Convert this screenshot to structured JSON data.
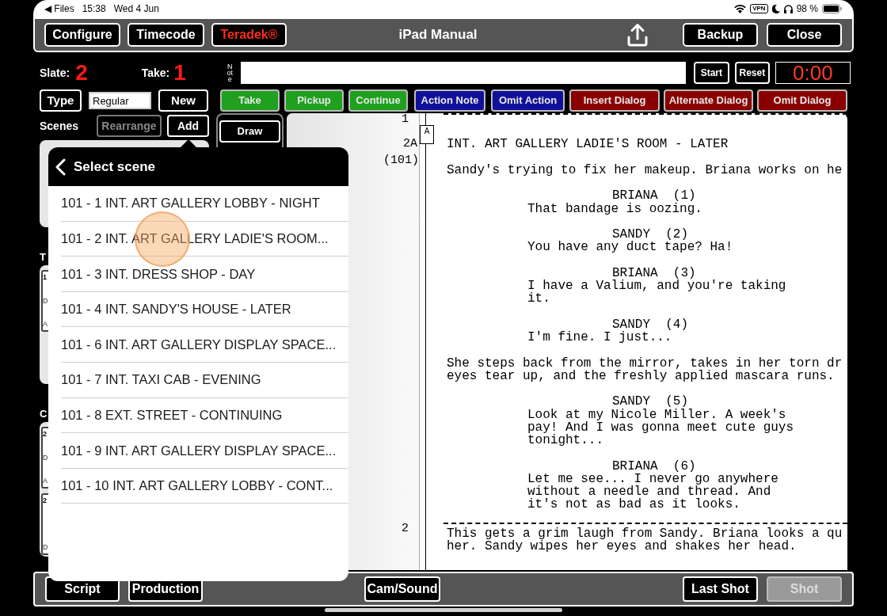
{
  "status_bar": {
    "back_link": "◀ Files",
    "time": "15:38",
    "date": "Wed 4 Jun",
    "vpn": "VPN",
    "battery": "98 %"
  },
  "header": {
    "title": "iPad Manual",
    "left_buttons": [
      {
        "label": "Configure",
        "kind": "plain"
      },
      {
        "label": "Timecode",
        "kind": "plain"
      },
      {
        "label": "Teradek®",
        "kind": "accent"
      }
    ],
    "right_buttons": [
      {
        "label": "Backup"
      },
      {
        "label": "Close"
      }
    ]
  },
  "slate": {
    "label": "Slate:",
    "value": "2"
  },
  "take": {
    "label": "Take:",
    "value": "1"
  },
  "note": {
    "label": "Note"
  },
  "timer": {
    "buttons": [
      "Start",
      "Reset"
    ],
    "display": "0:00"
  },
  "type_row": {
    "button": "Type",
    "value": "Regular",
    "new_button": "New"
  },
  "shot_types": [
    {
      "label": "Take",
      "color": "#1fa01f"
    },
    {
      "label": "Pickup",
      "color": "#1fa01f"
    },
    {
      "label": "Continue",
      "color": "#1fa01f"
    },
    {
      "label": "Action Note",
      "color": "#10109a"
    },
    {
      "label": "Omit Action",
      "color": "#10109a"
    },
    {
      "label": "Insert Dialog",
      "color": "#8a0000"
    },
    {
      "label": "Alternate Dialog",
      "color": "#8a0000"
    },
    {
      "label": "Omit Dialog",
      "color": "#8a0000"
    }
  ],
  "scenes": {
    "label": "Scenes",
    "buttons": [
      {
        "label": "Rearrange",
        "disabled": true
      },
      {
        "label": "Add",
        "disabled": false
      }
    ]
  },
  "left_panel": {
    "sections": [
      {
        "label": "T",
        "cards": [
          {
            "lines": [
              "1",
              "D",
              "A"
            ]
          }
        ]
      },
      {
        "label": "C",
        "cards": [
          {
            "lines": [
              "2",
              "D",
              "A"
            ]
          },
          {
            "lines": [
              "2",
              "D"
            ]
          }
        ]
      }
    ]
  },
  "draw_button": "Draw",
  "script": {
    "blocks": [
      {
        "kind": "break",
        "number": "1"
      },
      {
        "kind": "heading",
        "number": "2A",
        "original": "(101)",
        "tag": "A",
        "lines": [
          "INT. ART GALLERY LADIE'S ROOM - LATER"
        ]
      },
      {
        "kind": "action",
        "lines": [
          "Sandy's trying to fix her makeup. Briana works on he"
        ]
      },
      {
        "kind": "character",
        "lines": [
          "BRIANA  (1)"
        ]
      },
      {
        "kind": "dialogue",
        "lines": [
          "That bandage is oozing."
        ]
      },
      {
        "kind": "character",
        "lines": [
          "SANDY  (2)"
        ]
      },
      {
        "kind": "dialogue",
        "lines": [
          "You have any duct tape? Ha!"
        ]
      },
      {
        "kind": "character",
        "lines": [
          "BRIANA  (3)"
        ]
      },
      {
        "kind": "dialogue",
        "lines": [
          "I have a Valium, and you're taking",
          "it."
        ]
      },
      {
        "kind": "character",
        "lines": [
          "SANDY  (4)"
        ]
      },
      {
        "kind": "dialogue",
        "lines": [
          "I'm fine. I just..."
        ]
      },
      {
        "kind": "action",
        "lines": [
          "She steps back from the mirror, takes in her torn dr",
          "eyes tear up, and the freshly applied mascara runs."
        ]
      },
      {
        "kind": "character",
        "lines": [
          "SANDY  (5)"
        ]
      },
      {
        "kind": "dialogue",
        "lines": [
          "Look at my Nicole Miller. A week's",
          "pay! And I was gonna meet cute guys",
          "tonight..."
        ]
      },
      {
        "kind": "character",
        "lines": [
          "BRIANA  (6)"
        ]
      },
      {
        "kind": "dialogue",
        "lines": [
          "Let me see... I never go anywhere",
          "without a needle and thread. And",
          "it's not as bad as it looks."
        ]
      },
      {
        "kind": "break",
        "number": "2"
      },
      {
        "kind": "action",
        "lines": [
          "This gets a grim laugh from Sandy. Briana looks a qu",
          "her. Sandy wipes her eyes and shakes her head."
        ]
      }
    ]
  },
  "bottom_bar": {
    "buttons": [
      {
        "label": "Script",
        "disabled": false
      },
      {
        "label": "Production",
        "disabled": false
      },
      {
        "label": "Cam/Sound",
        "disabled": false
      },
      {
        "label": "Last Shot",
        "disabled": false
      },
      {
        "label": "Shot",
        "disabled": true
      }
    ]
  },
  "popover": {
    "title": "Select scene",
    "items": [
      "101 - 1 INT. ART GALLERY LOBBY - NIGHT",
      "101 - 2 INT. ART GALLERY LADIE'S ROOM...",
      "101 - 3 INT. DRESS SHOP - DAY",
      "101 - 4 INT. SANDY'S HOUSE - LATER",
      "101 - 6 INT. ART GALLERY DISPLAY SPACE...",
      "101 - 7 INT. TAXI CAB - EVENING",
      "101 - 8 EXT. STREET - CONTINUING",
      "101 - 9 INT. ART GALLERY DISPLAY SPACE...",
      "101 - 10 INT. ART GALLERY LOBBY - CONT..."
    ]
  }
}
